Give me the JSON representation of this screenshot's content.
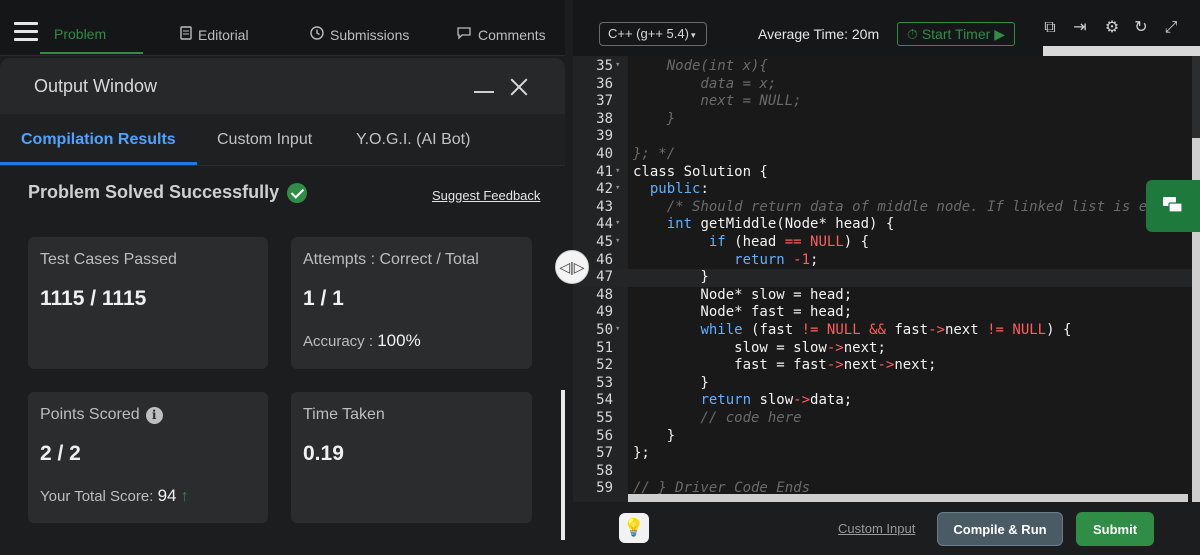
{
  "nav": {
    "tabs": [
      {
        "label": "Problem",
        "icon": "hamburger-icon"
      },
      {
        "label": "Editorial",
        "icon": "document-icon"
      },
      {
        "label": "Submissions",
        "icon": "clock-icon"
      },
      {
        "label": "Comments",
        "icon": "chat-bubble-icon"
      }
    ]
  },
  "output": {
    "title": "Output Window",
    "tabs": [
      "Compilation Results",
      "Custom Input",
      "Y.O.G.I. (AI Bot)"
    ],
    "status": "Problem Solved Successfully",
    "feedback_link": "Suggest Feedback",
    "cards": {
      "tests": {
        "label": "Test Cases Passed",
        "value": "1115 / 1115"
      },
      "attempts": {
        "label": "Attempts : Correct / Total",
        "value": "1 / 1",
        "accuracy_label": "Accuracy :",
        "accuracy_value": "100%"
      },
      "points": {
        "label": "Points Scored",
        "value": "2 / 2",
        "total_label": "Your Total Score:",
        "total_value": "94"
      },
      "time": {
        "label": "Time Taken",
        "value": "0.19"
      }
    }
  },
  "editor": {
    "language": "C++ (g++ 5.4)",
    "average_time": "Average Time: 20m",
    "timer_label": "Start Timer",
    "code_lines": [
      {
        "n": "35",
        "t": "    Node(int x){"
      },
      {
        "n": "36",
        "t": "        data = x;"
      },
      {
        "n": "37",
        "t": "        next = NULL;"
      },
      {
        "n": "38",
        "t": "    }"
      },
      {
        "n": "39",
        "t": ""
      },
      {
        "n": "40",
        "t": "}; */"
      },
      {
        "n": "41",
        "t": "class Solution {"
      },
      {
        "n": "42",
        "t": "  public:"
      },
      {
        "n": "43",
        "t": "    /* Should return data of middle node. If linked list is e"
      },
      {
        "n": "44",
        "t": "    int getMiddle(Node* head) {"
      },
      {
        "n": "45",
        "t": "         if (head == NULL) {"
      },
      {
        "n": "46",
        "t": "            return -1;"
      },
      {
        "n": "47",
        "t": "        }"
      },
      {
        "n": "48",
        "t": "        Node* slow = head;"
      },
      {
        "n": "49",
        "t": "        Node* fast = head;"
      },
      {
        "n": "50",
        "t": "        while (fast != NULL && fast->next != NULL) {"
      },
      {
        "n": "51",
        "t": "            slow = slow->next;"
      },
      {
        "n": "52",
        "t": "            fast = fast->next->next;"
      },
      {
        "n": "53",
        "t": "        }"
      },
      {
        "n": "54",
        "t": "        return slow->data;"
      },
      {
        "n": "55",
        "t": "        // code here"
      },
      {
        "n": "56",
        "t": "    }"
      },
      {
        "n": "57",
        "t": "};"
      },
      {
        "n": "58",
        "t": ""
      },
      {
        "n": "59",
        "t": "// } Driver Code Ends"
      }
    ],
    "custom_input_link": "Custom Input",
    "compile_label": "Compile & Run",
    "submit_label": "Submit"
  },
  "colors": {
    "accent_green": "#2f8d46",
    "accent_blue": "#1e7ce0",
    "keyword_blue": "#5fb0ff",
    "null_red": "#ff5d5d"
  }
}
